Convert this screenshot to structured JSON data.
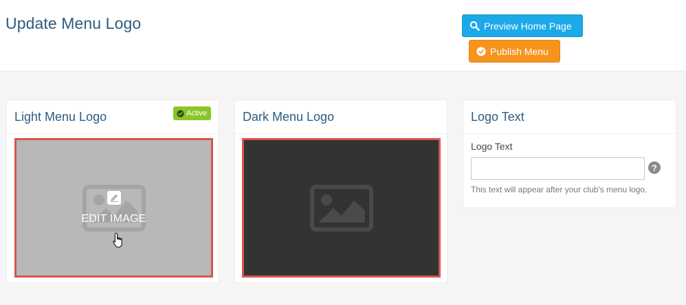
{
  "header": {
    "title": "Update Menu Logo",
    "preview_label": "Preview Home Page",
    "publish_label": "Publish Menu"
  },
  "light_panel": {
    "title": "Light Menu Logo",
    "badge": "Active",
    "edit_label": "EDIT IMAGE",
    "image_bg": "#b8b8b8"
  },
  "dark_panel": {
    "title": "Dark Menu Logo",
    "image_bg": "#333333"
  },
  "text_panel": {
    "title": "Logo Text",
    "field_label": "Logo Text",
    "field_value": "",
    "help_icon": "?",
    "help_text": "This text will appear after your club's menu logo."
  },
  "colors": {
    "title": "#2d5c80",
    "preview_button": "#1ba9e9",
    "publish_button": "#f6941e",
    "badge": "#8bc528",
    "image_border": "#d9534f"
  },
  "icons": {
    "preview": "search-icon",
    "publish": "check-circle-icon",
    "badge": "check-circle-icon",
    "placeholder": "image-placeholder-icon",
    "edit": "edit-icon",
    "cursor": "hand-pointer-icon"
  }
}
